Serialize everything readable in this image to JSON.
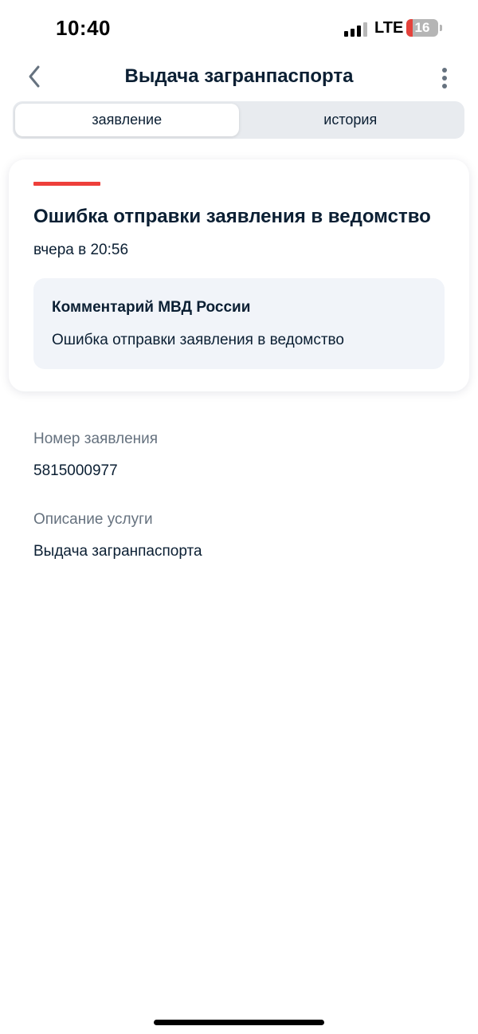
{
  "status_bar": {
    "time": "10:40",
    "network": "LTE",
    "battery": "16",
    "battery_color": "#e5423b"
  },
  "header": {
    "title": "Выдача загранпаспорта",
    "back_icon": "chevron-left-icon",
    "menu_icon": "more-vertical-icon"
  },
  "tabs": [
    {
      "label": "заявление",
      "active": true
    },
    {
      "label": "история",
      "active": false
    }
  ],
  "status_card": {
    "accent_color": "#ee3f3a",
    "title": "Ошибка отправки заявления в ведомство",
    "date": "вчера в 20:56",
    "comment": {
      "title": "Комментарий МВД России",
      "text": "Ошибка отправки заявления в ведомство"
    }
  },
  "details": [
    {
      "label": "Номер заявления",
      "value": "5815000977"
    },
    {
      "label": "Описание услуги",
      "value": "Выдача загранпаспорта"
    }
  ]
}
